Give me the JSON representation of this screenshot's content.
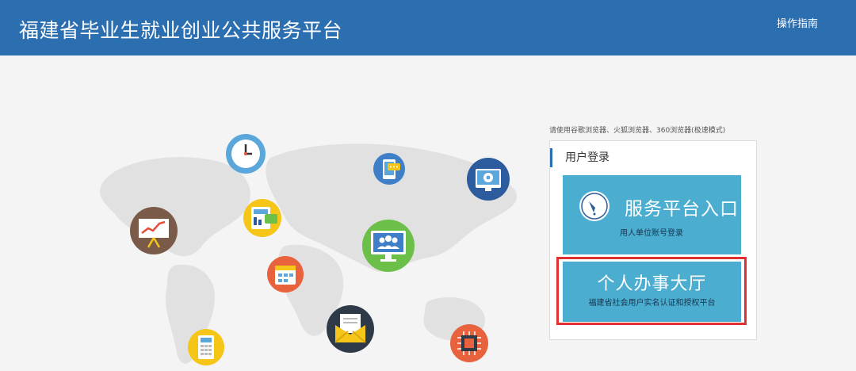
{
  "header": {
    "title": "福建省毕业生就业创业公共服务平台",
    "guide_label": "操作指南",
    "background": "#2c6fb1"
  },
  "illustration": {
    "icons": [
      "clock-icon",
      "phone-chat-icon",
      "gear-monitor-icon",
      "presentation-chart-icon",
      "report-card-icon",
      "team-monitor-icon",
      "calendar-icon",
      "mail-icon",
      "calculator-icon",
      "chip-icon"
    ]
  },
  "login": {
    "browser_hint": "请使用谷歌浏览器、火狐浏览器、360浏览器(极速模式)",
    "panel_title": "用户登录",
    "service_entry": {
      "title": "服务平台入口",
      "subtitle": "用人单位账号登录"
    },
    "personal_hall": {
      "title": "个人办事大厅",
      "subtitle": "福建省社会用户实名认证和授权平台"
    },
    "accent_color": "#4badd0",
    "highlight_color": "#e03030"
  }
}
